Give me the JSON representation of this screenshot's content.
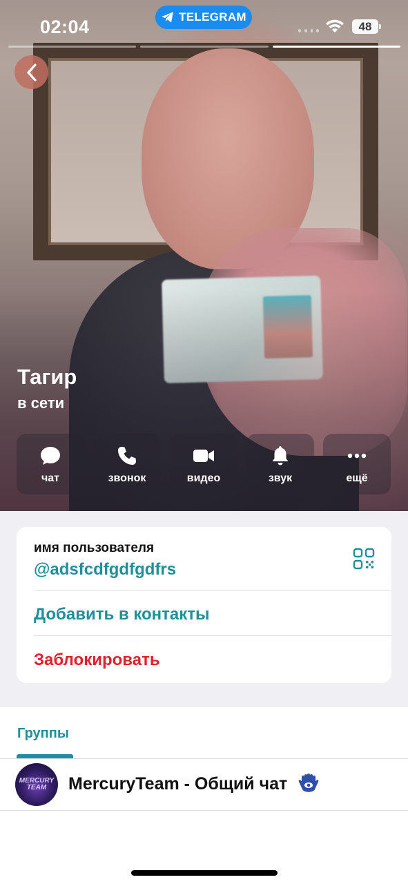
{
  "status_bar": {
    "time": "02:04",
    "app_pill": "TELEGRAM",
    "battery": "48",
    "story_segments": 3,
    "active_segment": 3
  },
  "profile": {
    "name": "Тагир",
    "status": "в сети"
  },
  "actions": [
    {
      "label": "чат",
      "icon": "chat-icon"
    },
    {
      "label": "звонок",
      "icon": "phone-icon"
    },
    {
      "label": "видео",
      "icon": "video-icon"
    },
    {
      "label": "звук",
      "icon": "bell-icon"
    },
    {
      "label": "ещё",
      "icon": "more-icon"
    }
  ],
  "info": {
    "username_label": "имя пользователя",
    "username": "@adsfcdfgdfgdfrs",
    "add_contact": "Добавить в контакты",
    "block": "Заблокировать"
  },
  "groups": {
    "tab_label": "Группы",
    "items": [
      {
        "name": "MercuryTeam - Общий чат",
        "avatar_text": "MERCURY TEAM",
        "emoji": "hamsa-icon"
      }
    ]
  },
  "colors": {
    "accent": "#1f8f9a",
    "danger": "#e0202a",
    "telegram_pill": "#1a8cf0"
  }
}
